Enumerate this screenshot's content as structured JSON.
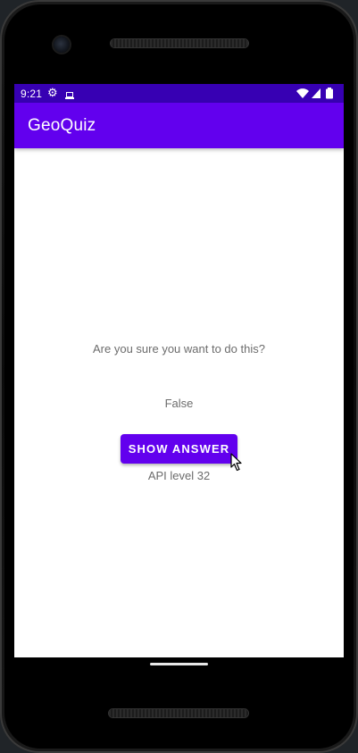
{
  "status_bar": {
    "time": "9:21",
    "settings_icon": "gear-icon",
    "device_icon": "device-icon",
    "wifi_icon": "wifi-icon",
    "signal_icon": "cell-signal-icon",
    "battery_icon": "battery-icon",
    "background_color": "#3700b3"
  },
  "app_bar": {
    "title": "GeoQuiz",
    "background_color": "#6200ee"
  },
  "content": {
    "question": "Are you sure you want to do this?",
    "answer": "False",
    "show_answer_label": "SHOW ANSWER",
    "api_level": "API level 32"
  },
  "colors": {
    "accent": "#6200ee",
    "text_secondary": "#6c6c6c"
  },
  "navigation": {
    "home_indicator_icon": "home-pill-icon"
  }
}
